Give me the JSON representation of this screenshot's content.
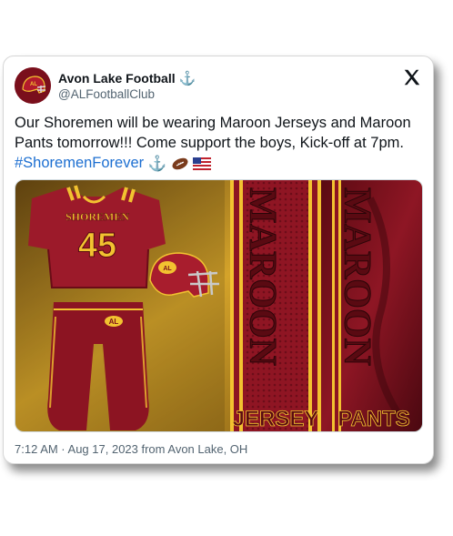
{
  "author": {
    "name": "Avon Lake Football",
    "handle": "@ALFootballClub",
    "badge_icon": "anchor-icon"
  },
  "tweet": {
    "text_main": "Our Shoremen will be wearing Maroon Jerseys and Maroon Pants tomorrow!!!  Come support the boys, Kick-off at 7pm. ",
    "hashtag": "#ShoremenForever",
    "emojis": [
      "anchor-icon",
      "football-icon",
      "us-flag-icon"
    ]
  },
  "media": {
    "jersey_text": "SHOREMEN",
    "jersey_number": "45",
    "panel_left_big": "MAROON",
    "panel_left_small": "JERSEY",
    "panel_right_big": "MAROON",
    "panel_right_small": "PANTS",
    "helmet_logo": "AL"
  },
  "meta": {
    "timestamp": "7:12 AM · Aug 17, 2023 from Avon Lake, OH"
  },
  "colors": {
    "maroon": "#7a0f1c",
    "gold": "#f2c230",
    "link": "#1d6fd1"
  }
}
